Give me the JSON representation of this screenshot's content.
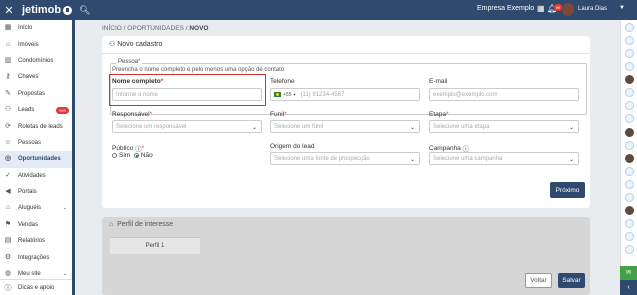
{
  "topbar": {
    "brand": "jetimob",
    "company": "Empresa Exemplo",
    "badge": "99",
    "user": "Laura Dias"
  },
  "sidebar": {
    "items": [
      {
        "label": "Início",
        "icon": "grid-icon"
      },
      {
        "label": "Imóveis",
        "icon": "home-icon"
      },
      {
        "label": "Condomínios",
        "icon": "building-icon"
      },
      {
        "label": "Chaves",
        "icon": "key-icon"
      },
      {
        "label": "Propostas",
        "icon": "proposal-icon"
      },
      {
        "label": "Leads",
        "icon": "leads-icon",
        "badge": "999"
      },
      {
        "label": "Roletas de leads",
        "icon": "roulette-icon"
      },
      {
        "label": "Pessoas",
        "icon": "people-icon"
      },
      {
        "label": "Oportunidades",
        "icon": "opportunity-icon"
      },
      {
        "label": "Atividades",
        "icon": "check-icon"
      },
      {
        "label": "Portais",
        "icon": "megaphone-icon"
      },
      {
        "label": "Aluguéis",
        "icon": "rent-icon",
        "chevron": true
      },
      {
        "label": "Vendas",
        "icon": "sales-icon"
      },
      {
        "label": "Relatórios",
        "icon": "report-icon"
      },
      {
        "label": "Integrações",
        "icon": "integration-icon"
      },
      {
        "label": "Meu site",
        "icon": "globe-icon",
        "chevron": true
      }
    ],
    "footer": "Dicas e apoio"
  },
  "breadcrumb": {
    "home": "INÍCIO",
    "section": "OPORTUNIDADES",
    "current": "NOVO"
  },
  "form": {
    "title": "Novo cadastro",
    "pessoa_legend": "Pessoa",
    "pessoa_hint": "Preencha o nome completo e pelo menos uma opção de contato",
    "nome_label": "Nome completo",
    "nome_placeholder": "Informe o nome",
    "telefone_label": "Telefone",
    "telefone_code": "+55",
    "telefone_placeholder": "(11) 91234-4567",
    "email_label": "E-mail",
    "email_placeholder": "exemplo@exemplo.com",
    "responsavel_label": "Responsável",
    "responsavel_placeholder": "Selecione um responsável",
    "funil_label": "Funil",
    "funil_placeholder": "Selecione um funil",
    "etapa_label": "Etapa",
    "etapa_placeholder": "Selecione uma etapa",
    "publico_label": "Público",
    "sim": "Sim",
    "nao": "Não",
    "origem_label": "Origem do lead",
    "origem_placeholder": "Selecione uma fonte de prospecção",
    "campanha_label": "Campanha",
    "campanha_placeholder": "Selecione uma campanha",
    "next": "Próximo"
  },
  "perfil": {
    "title": "Perfil de interesse",
    "tab": "Perfil 1",
    "back": "Voltar",
    "save": "Salvar"
  }
}
